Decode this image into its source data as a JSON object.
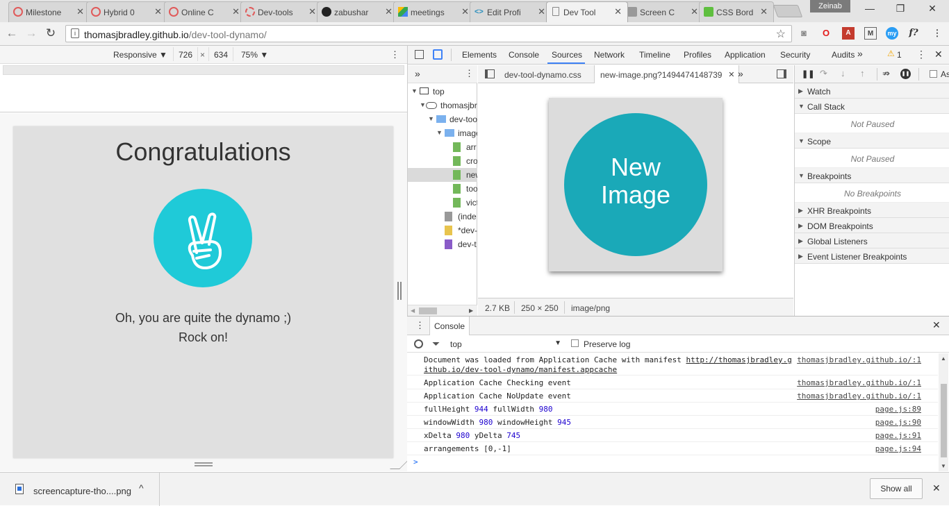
{
  "browser": {
    "tabs": [
      {
        "title": "Milestone",
        "favicon_color": "#e05a5a"
      },
      {
        "title": "Hybrid 0",
        "favicon_color": "#e05a5a"
      },
      {
        "title": "Online C",
        "favicon_color": "#e05a5a"
      },
      {
        "title": "Dev-tools",
        "favicon_color": "#e05a5a"
      },
      {
        "title": "zabushar",
        "favicon_color": "#222222"
      },
      {
        "title": "meetings",
        "favicon_color": "#34a853"
      },
      {
        "title": "Edit Profi",
        "favicon_color": "#2a8fbd"
      },
      {
        "title": "Dev Tool",
        "favicon_color": "#888888",
        "active": true
      },
      {
        "title": "Screen C",
        "favicon_color": "#888888"
      },
      {
        "title": "CSS Bord",
        "favicon_color": "#5fbf3f"
      }
    ],
    "profile_name": "Zeinab",
    "url_host": "thomasjbradley.github.io",
    "url_path": "/dev-tool-dynamo/",
    "window_controls": {
      "minimize": "—",
      "restore": "❐",
      "close": "✕"
    }
  },
  "device_toolbar": {
    "mode": "Responsive",
    "width": "726",
    "times": "×",
    "height": "634",
    "zoom": "75%"
  },
  "page": {
    "title": "Congratulations",
    "line1": "Oh, you are quite the dynamo ;)",
    "line2": "Rock on!",
    "accent_color": "#1fcad8"
  },
  "devtools": {
    "tabs": [
      "Elements",
      "Console",
      "Sources",
      "Network",
      "Timeline",
      "Profiles",
      "Application",
      "Security",
      "Audits"
    ],
    "more": "»",
    "warning_count": "1",
    "selected_tab": "Sources",
    "tree": [
      {
        "label": "top",
        "kind": "frame"
      },
      {
        "label": "thomasjbr",
        "kind": "cloud"
      },
      {
        "label": "dev-tool",
        "kind": "folder"
      },
      {
        "label": "image",
        "kind": "folder"
      },
      {
        "label": "arr",
        "kind": "image"
      },
      {
        "label": "cro",
        "kind": "image"
      },
      {
        "label": "new",
        "kind": "image",
        "selected": true
      },
      {
        "label": "too",
        "kind": "image"
      },
      {
        "label": "vict",
        "kind": "image"
      },
      {
        "label": "(inde",
        "kind": "doc"
      },
      {
        "label": "*dev-",
        "kind": "script"
      },
      {
        "label": "dev-t",
        "kind": "stylesheet"
      }
    ],
    "editor_tabs": [
      "dev-tool-dynamo.css",
      "new-image.png?1494474148739"
    ],
    "preview_text_1": "New",
    "preview_text_2": "Image",
    "preview_color": "#1aa9b8",
    "image_info": {
      "size": "2.7 KB",
      "dimensions": "250 × 250",
      "mime": "image/png"
    },
    "debugger": {
      "checkbox_label": "As",
      "sections": [
        {
          "title": "Watch",
          "expanded": false
        },
        {
          "title": "Call Stack",
          "expanded": true,
          "note": "Not Paused"
        },
        {
          "title": "Scope",
          "expanded": true,
          "note": "Not Paused"
        },
        {
          "title": "Breakpoints",
          "expanded": true,
          "note": "No Breakpoints"
        },
        {
          "title": "XHR Breakpoints",
          "expanded": false
        },
        {
          "title": "DOM Breakpoints",
          "expanded": false
        },
        {
          "title": "Global Listeners",
          "expanded": false
        },
        {
          "title": "Event Listener Breakpoints",
          "expanded": false
        }
      ]
    }
  },
  "console": {
    "tab": "Console",
    "context": "top",
    "preserve_log": "Preserve log",
    "prompt": ">",
    "rows": [
      {
        "msg1": "Document was loaded from Application Cache with manifest ",
        "link1": "http://thomasjbradley.g",
        "link2": "ithub.io/dev-tool-dynamo/manifest.appcache",
        "src": "thomasjbradley.github.io/:1"
      },
      {
        "msg": "Application Cache Checking event",
        "src": "thomasjbradley.github.io/:1"
      },
      {
        "msg": "Application Cache NoUpdate event",
        "src": "thomasjbradley.github.io/:1"
      },
      {
        "p1": "fullHeight ",
        "n1": "944",
        "p2": " fullWidth ",
        "n2": "980",
        "src": "page.js:89"
      },
      {
        "p1": "windowWidth ",
        "n1": "980",
        "p2": " windowHeight ",
        "n2": "945",
        "src": "page.js:90"
      },
      {
        "p1": "xDelta ",
        "n1": "980",
        "p2": " yDelta ",
        "n2": "745",
        "src": "page.js:91"
      },
      {
        "msg": "arrangements [0,-1]",
        "src": "page.js:94"
      }
    ]
  },
  "downloads": {
    "file": "screencapture-tho....png",
    "show_all": "Show all",
    "close": "✕"
  }
}
